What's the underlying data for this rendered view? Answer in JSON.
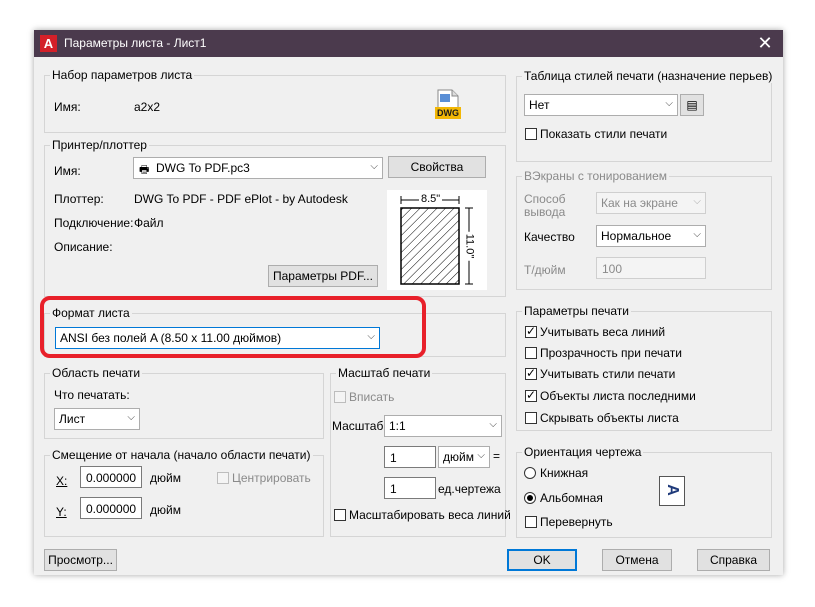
{
  "window": {
    "title": "Параметры листа - Лист1",
    "app_icon": "A",
    "close": "✕"
  },
  "page_setup": {
    "group": "Набор параметров листа",
    "name_label": "Имя:",
    "name_value": "a2x2",
    "icon": "dwg-file-icon",
    "icon_text": "DWG"
  },
  "printer": {
    "group": "Принтер/плоттер",
    "name_label": "Имя:",
    "name_value": "DWG To PDF.pc3",
    "properties_button": "Свойства",
    "plotter_label": "Плоттер:",
    "plotter_value": "DWG To PDF - PDF ePlot - by Autodesk",
    "connection_label": "Подключение:",
    "connection_value": "Файл",
    "description_label": "Описание:",
    "pdf_options_button": "Параметры PDF...",
    "paper_width": "8.5\"",
    "paper_height": "11.0\""
  },
  "paper_size": {
    "group": "Формат листа",
    "value": "ANSI без полей A (8.50 x 11.00 дюймов)"
  },
  "plot_area": {
    "group": "Область печати",
    "what_label": "Что печатать:",
    "what_value": "Лист"
  },
  "plot_offset": {
    "group": "Смещение от начала (начало области печати)",
    "x_label": "X:",
    "x_value": "0.000000",
    "y_label": "Y:",
    "y_value": "0.000000",
    "unit": "дюйм",
    "center": "Центрировать"
  },
  "plot_scale": {
    "group": "Масштаб печати",
    "fit": "Вписать",
    "scale_label": "Масштаб:",
    "scale_value": "1:1",
    "val1": "1",
    "unit1": "дюйм",
    "val2": "1",
    "unit2": "ед.чертежа",
    "scale_lineweights": "Масштабировать веса линий"
  },
  "plot_style": {
    "group": "Таблица стилей печати (назначение перьев)",
    "value": "Нет",
    "show_styles": "Показать стили печати"
  },
  "shaded": {
    "group": "ВЭкраны с тонированием",
    "mode_label1": "Способ",
    "mode_label2": "вывода",
    "mode_value": "Как на экране",
    "quality_label": "Качество",
    "quality_value": "Нормальное",
    "dpi_label": "Т/дюйм",
    "dpi_value": "100"
  },
  "plot_options": {
    "group": "Параметры печати",
    "items": [
      {
        "label": "Учитывать веса линий",
        "checked": true
      },
      {
        "label": "Прозрачность при печати",
        "checked": false
      },
      {
        "label": "Учитывать стили печати",
        "checked": true
      },
      {
        "label": "Объекты листа последними",
        "checked": true
      },
      {
        "label": "Скрывать объекты листа",
        "checked": false
      }
    ]
  },
  "orientation": {
    "group": "Ориентация чертежа",
    "portrait": "Книжная",
    "landscape": "Альбомная",
    "upside_down": "Перевернуть",
    "preview_glyph": "A"
  },
  "footer": {
    "preview": "Просмотр...",
    "ok": "OK",
    "cancel": "Отмена",
    "help": "Справка"
  }
}
